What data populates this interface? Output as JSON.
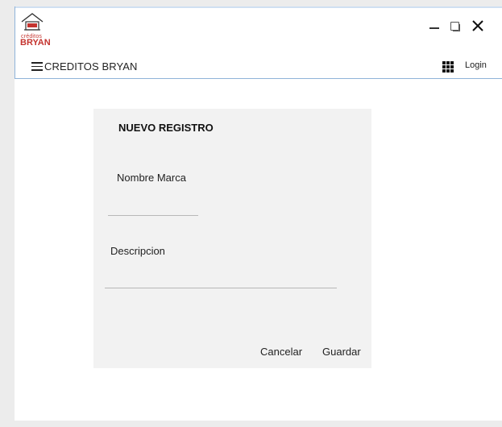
{
  "logo": {
    "small_text": "créditos",
    "big_text": "BRYAN"
  },
  "window_controls": {
    "minimize": "minimize-icon",
    "maximize": "maximize-icon",
    "close": "close-icon"
  },
  "navbar": {
    "menu_icon": "hamburger-icon",
    "title": "CREDITOS BRYAN",
    "apps_icon": "grid-icon",
    "login_label": "Login"
  },
  "form": {
    "title": "NUEVO REGISTRO",
    "nombre_label": "Nombre Marca",
    "nombre_value": "",
    "descripcion_label": "Descripcion",
    "descripcion_value": "",
    "cancel_label": "Cancelar",
    "save_label": "Guardar"
  },
  "colors": {
    "brand": "#c4342f",
    "accent_border": "#8fb3d9",
    "card_bg": "#f2f2f2"
  }
}
